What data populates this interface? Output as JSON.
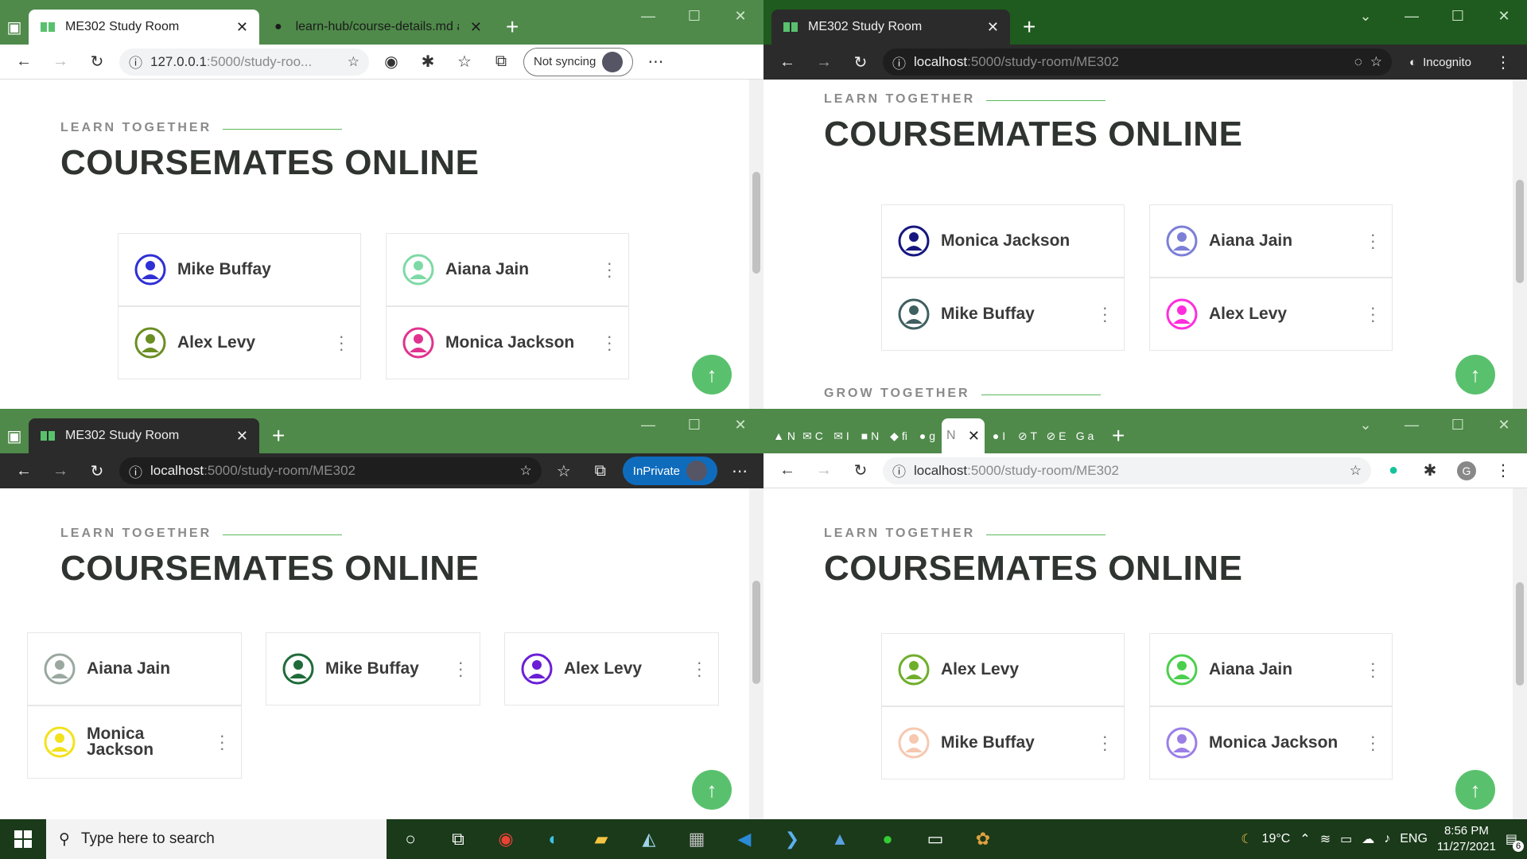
{
  "windows": [
    {
      "tabs": [
        {
          "title": "ME302 Study Room"
        },
        {
          "title": "learn-hub/course-details.md at m"
        }
      ],
      "address": {
        "host": "127.0.0.1",
        "path": ":5000/study-roo..."
      },
      "profile_label": "Not syncing",
      "page": {
        "kicker": "LEARN TOGETHER",
        "heading": "COURSEMATES ONLINE",
        "members": [
          {
            "name": "Mike Buffay",
            "color": "#2f2fd6"
          },
          {
            "name": "Aiana Jain",
            "color": "#7ed9a6"
          },
          {
            "name": "Alex Levy",
            "color": "#6b8e23"
          },
          {
            "name": "Monica Jackson",
            "color": "#e0338f"
          }
        ]
      }
    },
    {
      "tabs": [
        {
          "title": "ME302 Study Room"
        }
      ],
      "address": {
        "host": "localhost",
        "path": ":5000/study-room/ME302"
      },
      "profile_label": "Incognito",
      "page": {
        "kicker": "LEARN TOGETHER",
        "heading": "COURSEMATES ONLINE",
        "kicker2": "GROW TOGETHER",
        "members": [
          {
            "name": "Monica Jackson",
            "color": "#161680"
          },
          {
            "name": "Aiana Jain",
            "color": "#7b7fd6"
          },
          {
            "name": "Mike Buffay",
            "color": "#3f5f60"
          },
          {
            "name": "Alex Levy",
            "color": "#ff2ddc"
          }
        ]
      }
    },
    {
      "tabs": [
        {
          "title": "ME302 Study Room"
        }
      ],
      "address": {
        "host": "localhost",
        "path": ":5000/study-room/ME302"
      },
      "profile_label": "InPrivate",
      "page": {
        "kicker": "LEARN TOGETHER",
        "heading": "COURSEMATES ONLINE",
        "members": [
          {
            "name": "Aiana Jain",
            "color": "#9aa8a0"
          },
          {
            "name": "Mike Buffay",
            "color": "#1f6b3a"
          },
          {
            "name": "Alex Levy",
            "color": "#6a1fd6"
          },
          {
            "name": "Monica Jackson",
            "color": "#f2e21b"
          }
        ]
      }
    },
    {
      "tabs": [
        {
          "title": "N"
        },
        {
          "title": "C"
        },
        {
          "title": "I"
        },
        {
          "title": "N"
        },
        {
          "title": "fi"
        },
        {
          "title": "g"
        },
        {
          "title": "N"
        },
        {
          "title": "I"
        },
        {
          "title": "T"
        },
        {
          "title": "E"
        },
        {
          "title": "a"
        }
      ],
      "address": {
        "host": "localhost",
        "path": ":5000/study-room/ME302"
      },
      "profile_label": "G",
      "page": {
        "kicker": "LEARN TOGETHER",
        "heading": "COURSEMATES ONLINE",
        "members": [
          {
            "name": "Alex Levy",
            "color": "#6fae2b"
          },
          {
            "name": "Aiana Jain",
            "color": "#4ccf4c"
          },
          {
            "name": "Mike Buffay",
            "color": "#f6c8b0"
          },
          {
            "name": "Monica Jackson",
            "color": "#9b7fe6"
          }
        ]
      }
    }
  ],
  "taskbar": {
    "search_placeholder": "Type here to search",
    "weather": "19°C",
    "language": "ENG",
    "time": "8:56 PM",
    "date": "11/27/2021",
    "notifications": "6"
  }
}
